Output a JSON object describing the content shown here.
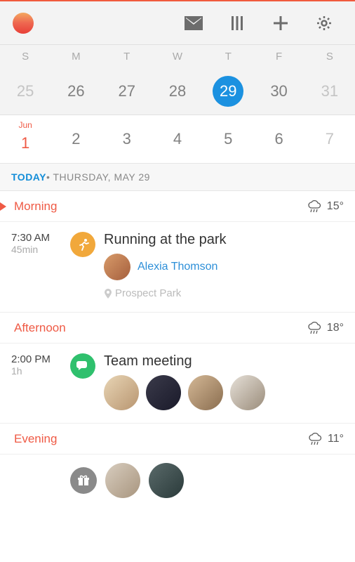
{
  "weekdays": [
    "S",
    "M",
    "T",
    "W",
    "T",
    "F",
    "S"
  ],
  "calendar": {
    "row1": [
      "25",
      "26",
      "27",
      "28",
      "29",
      "30",
      "31"
    ],
    "selectedIndex": 4,
    "row2": {
      "monthLabel": "Jun",
      "days": [
        "1",
        "2",
        "3",
        "4",
        "5",
        "6",
        "7"
      ]
    }
  },
  "dateHeader": {
    "today": "TODAY",
    "rest": " • THURSDAY, MAY 29"
  },
  "sections": {
    "morning": {
      "label": "Morning",
      "temp": "15°"
    },
    "afternoon": {
      "label": "Afternoon",
      "temp": "18°"
    },
    "evening": {
      "label": "Evening",
      "temp": "11°"
    }
  },
  "events": {
    "morning": {
      "time": "7:30 AM",
      "duration": "45min",
      "title": "Running at the park",
      "iconColor": "#f1a83b",
      "attendee": "Alexia Thomson",
      "location": "Prospect Park"
    },
    "afternoon": {
      "time": "2:00 PM",
      "duration": "1h",
      "title": "Team meeting",
      "iconColor": "#2fc06d"
    }
  }
}
